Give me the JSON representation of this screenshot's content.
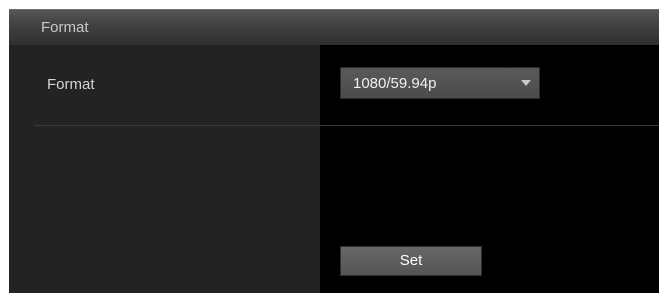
{
  "section": {
    "title": "Format"
  },
  "format_row": {
    "label": "Format",
    "select_value": "1080/59.94p"
  },
  "actions": {
    "set_label": "Set"
  },
  "colors": {
    "panel_background": "#000000",
    "label_column_background": "#232323",
    "header_background": "#3f3f3f",
    "control_background": "#555555",
    "text": "#d4d4d4"
  },
  "icons": {
    "select_arrow": "chevron-down-icon"
  }
}
